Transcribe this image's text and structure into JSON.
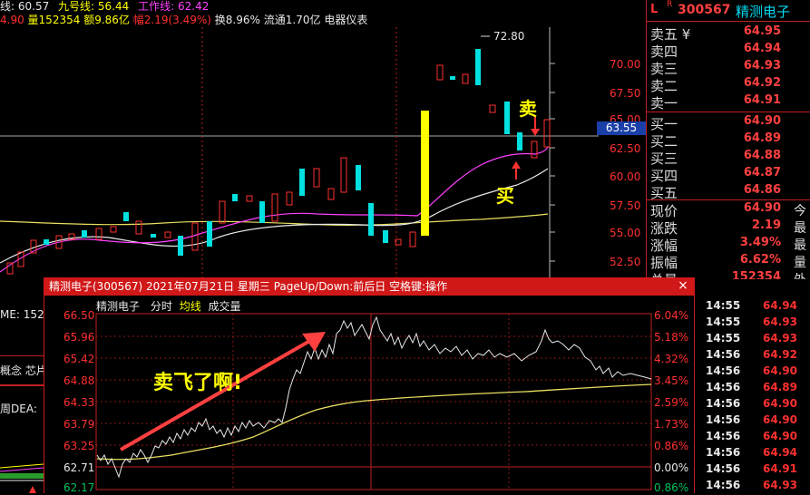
{
  "kline": {
    "indicators_line1": {
      "a": "线: 60.57",
      "b_label": "九号线:",
      "b_val": "56.44",
      "c_label": "工作线:",
      "c_val": "62.42"
    },
    "info_line2": {
      "price": "4.90",
      "vol": "量152354",
      "amount": "额9.86亿",
      "pct": "幅2.19(3.49%)",
      "turnover": "换8.96%",
      "float_cap": "流通1.70亿",
      "industry": "电器仪表"
    },
    "high_marker": "72.80",
    "current_price_tag": "63.55",
    "y_ticks": [
      "70.00",
      "67.50",
      "65.00",
      "62.50",
      "60.00",
      "57.50",
      "55.00",
      "52.50"
    ],
    "annotation_sell": "卖",
    "annotation_buy": "买",
    "left_labels": [
      "ME: 1523",
      "概念 芯片",
      "周DEA:"
    ]
  },
  "quote": {
    "flag": "L",
    "flag_r": "R",
    "code": "300567",
    "name": "精测电子",
    "sell": [
      {
        "label": "卖五 ¥",
        "price": "64.95"
      },
      {
        "label": "卖四",
        "price": "64.94"
      },
      {
        "label": "卖三",
        "price": "64.93"
      },
      {
        "label": "卖二",
        "price": "64.92"
      },
      {
        "label": "卖一",
        "price": "64.91"
      }
    ],
    "buy": [
      {
        "label": "买一",
        "price": "64.90"
      },
      {
        "label": "买二",
        "price": "64.89"
      },
      {
        "label": "买三",
        "price": "64.88"
      },
      {
        "label": "买四",
        "price": "64.87"
      },
      {
        "label": "买五",
        "price": "64.86"
      }
    ],
    "stats": [
      {
        "label": "现价",
        "value": "64.90",
        "right": "今"
      },
      {
        "label": "涨跌",
        "value": "2.19",
        "right": "最"
      },
      {
        "label": "涨幅",
        "value": "3.49%",
        "right": "最"
      },
      {
        "label": "振幅",
        "value": "6.62%",
        "right": "量"
      },
      {
        "label": "总量",
        "value": "152354",
        "right": "外"
      }
    ]
  },
  "popup": {
    "title": "精测电子(300567) 2021年07月21日 星期三 PageUp/Down:前后日 空格键:操作",
    "close": "×",
    "sub_name": "精测电子",
    "sub_mode": "分时",
    "sub_avg": "均线",
    "sub_vol": "成交量",
    "left_axis": [
      "66.50",
      "65.96",
      "65.42",
      "64.88",
      "64.33",
      "63.79",
      "63.25",
      "62.71",
      "62.17"
    ],
    "right_axis": [
      "6.04%",
      "5.18%",
      "4.32%",
      "3.45%",
      "2.59%",
      "1.73%",
      "0.86%",
      "0.00%",
      "0.86%"
    ],
    "annotation": "卖飞了啊!"
  },
  "ticks": [
    {
      "time": "14:55",
      "price": "64.94"
    },
    {
      "time": "14:55",
      "price": "64.93"
    },
    {
      "time": "14:55",
      "price": "64.93"
    },
    {
      "time": "14:56",
      "price": "64.92"
    },
    {
      "time": "14:56",
      "price": "64.90"
    },
    {
      "time": "14:56",
      "price": "64.89"
    },
    {
      "time": "14:56",
      "price": "64.90"
    },
    {
      "time": "14:56",
      "price": "64.90"
    },
    {
      "time": "14:56",
      "price": "64.90"
    },
    {
      "time": "14:56",
      "price": "64.94"
    },
    {
      "time": "14:56",
      "price": "64.91"
    },
    {
      "time": "14:56",
      "price": "64.93"
    }
  ],
  "colors": {
    "up": "#ff3030",
    "down": "#00e0e0",
    "yellow": "#ffff00",
    "magenta": "#ff40ff",
    "panel_red": "#d01818"
  }
}
